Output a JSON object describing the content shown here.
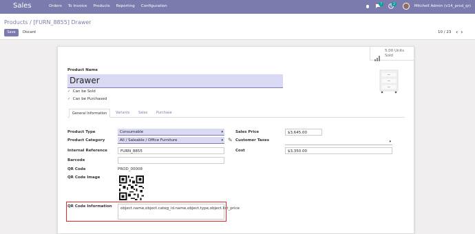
{
  "navbar": {
    "app_name": "Sales",
    "menu": [
      "Orders",
      "To Invoice",
      "Products",
      "Reporting",
      "Configuration"
    ],
    "chat_badge": "7",
    "activity_badge": "2",
    "user": "Mitchell Admin (v14_prod_qr)"
  },
  "breadcrumb": {
    "parent": "Products",
    "separator": "/",
    "current": "[FURN_8855] Drawer"
  },
  "actions": {
    "save": "Save",
    "discard": "Discard"
  },
  "pager": {
    "text": "10 / 23"
  },
  "stat_button": {
    "value": "5.00 Units",
    "label": "Sold"
  },
  "product": {
    "name_label": "Product Name",
    "name": "Drawer",
    "can_be_sold": "Can be Sold",
    "can_be_purchased": "Can be Purchased"
  },
  "tabs": [
    "General Information",
    "Variants",
    "Sales",
    "Purchase"
  ],
  "form": {
    "product_type_label": "Product Type",
    "product_type": "Consumable",
    "product_category_label": "Product Category",
    "product_category": "All / Saleable / Office Furniture",
    "internal_reference_label": "Internal Reference",
    "internal_reference": "FURN_8855",
    "barcode_label": "Barcode",
    "barcode": "",
    "qr_code_label": "QR Code",
    "qr_code": "PROD_00008",
    "qr_code_image_label": "QR Code Image",
    "qr_code_info_label": "QR Code Information",
    "qr_code_info": "object.name,object.categ_id.name,object.type,object.list_price",
    "sales_price_label": "Sales Price",
    "sales_price": "$3,645.00",
    "customer_taxes_label": "Customer Taxes",
    "customer_taxes": "",
    "cost_label": "Cost",
    "cost": "$3,350.00"
  },
  "colors": {
    "primary": "#7c7bad",
    "highlight": "#e3262b",
    "teal": "#00a09d"
  }
}
